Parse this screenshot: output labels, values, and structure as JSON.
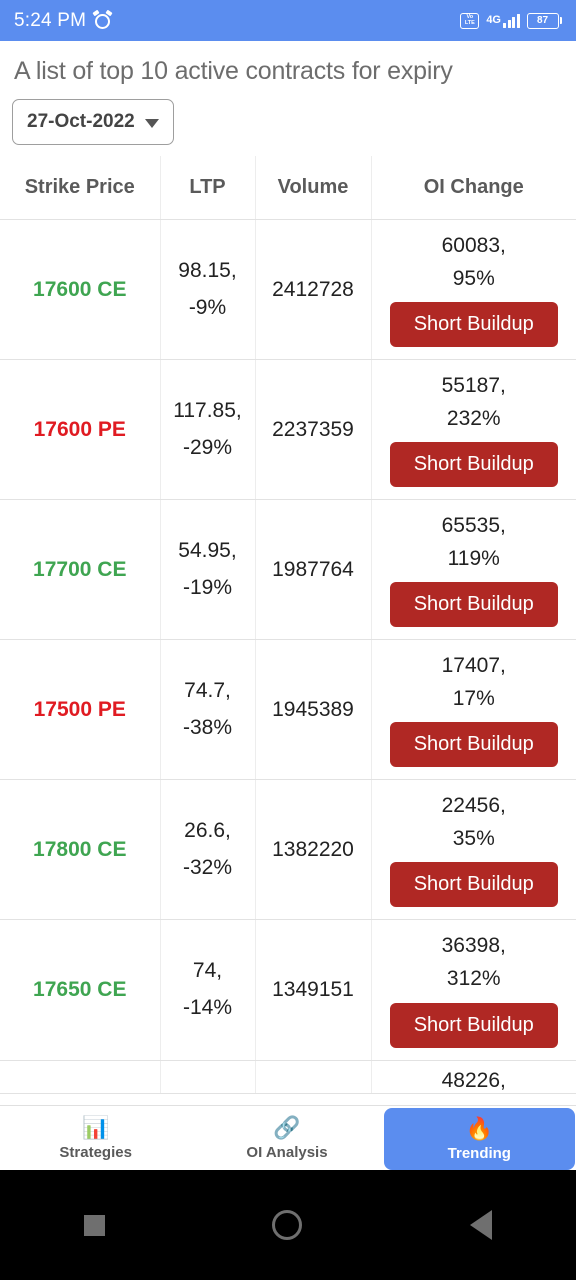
{
  "status_bar": {
    "time": "5:24 PM",
    "alarm_icon": "alarm-icon",
    "volte_line1": "Vo",
    "volte_line2": "LTE",
    "network": "4G",
    "battery_level": "87"
  },
  "header": {
    "title": "A list of top 10 active contracts for expiry",
    "expiry_selected": "27-Oct-2022"
  },
  "table": {
    "columns": [
      "Strike Price",
      "LTP",
      "Volume",
      "OI Change"
    ],
    "rows": [
      {
        "strike": "17600 CE",
        "type": "ce",
        "ltp": "98.15,",
        "ltp_change": "-9%",
        "volume": "2412728",
        "oi": "60083,",
        "oi_change": "95%",
        "signal": "Short Buildup"
      },
      {
        "strike": "17600 PE",
        "type": "pe",
        "ltp": "117.85,",
        "ltp_change": "-29%",
        "volume": "2237359",
        "oi": "55187,",
        "oi_change": "232%",
        "signal": "Short Buildup"
      },
      {
        "strike": "17700 CE",
        "type": "ce",
        "ltp": "54.95,",
        "ltp_change": "-19%",
        "volume": "1987764",
        "oi": "65535,",
        "oi_change": "119%",
        "signal": "Short Buildup"
      },
      {
        "strike": "17500 PE",
        "type": "pe",
        "ltp": "74.7,",
        "ltp_change": "-38%",
        "volume": "1945389",
        "oi": "17407,",
        "oi_change": "17%",
        "signal": "Short Buildup"
      },
      {
        "strike": "17800 CE",
        "type": "ce",
        "ltp": "26.6,",
        "ltp_change": "-32%",
        "volume": "1382220",
        "oi": "22456,",
        "oi_change": "35%",
        "signal": "Short Buildup"
      },
      {
        "strike": "17650 CE",
        "type": "ce",
        "ltp": "74,",
        "ltp_change": "-14%",
        "volume": "1349151",
        "oi": "36398,",
        "oi_change": "312%",
        "signal": "Short Buildup"
      }
    ],
    "partial_row": {
      "strike": "",
      "ltp": "",
      "volume": "",
      "oi": "48226,"
    }
  },
  "bottom_nav": {
    "items": [
      {
        "label": "Strategies",
        "icon": "bar-chart-icon",
        "glyph": "📊",
        "active": false
      },
      {
        "label": "OI Analysis",
        "icon": "chain-link-icon",
        "glyph": "🔗",
        "active": false
      },
      {
        "label": "Trending",
        "icon": "fire-icon",
        "glyph": "🔥",
        "active": true
      }
    ]
  },
  "android_nav": {
    "recents": "recents-square-icon",
    "home": "home-circle-icon",
    "back": "back-triangle-icon"
  },
  "colors": {
    "accent_blue": "#5b8def",
    "ce_green": "#3fa551",
    "pe_red": "#e01b22",
    "badge_red": "#b02824"
  }
}
